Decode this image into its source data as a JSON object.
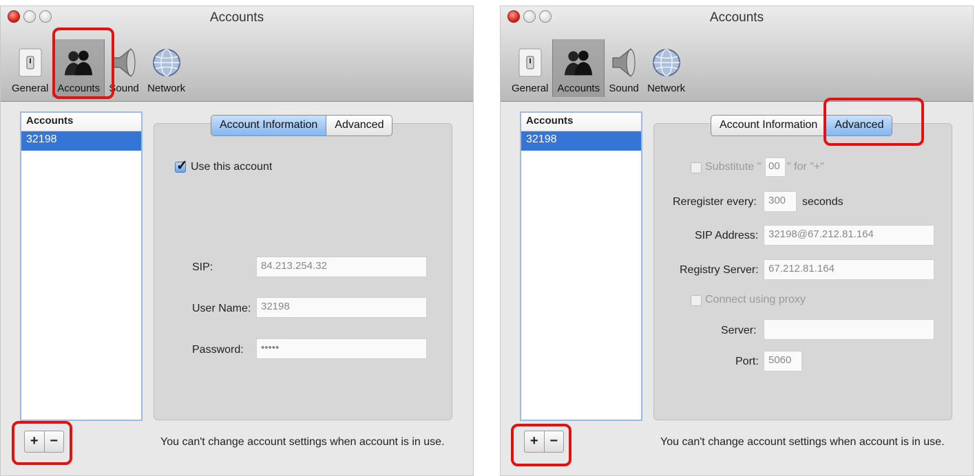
{
  "left": {
    "title": "Accounts",
    "toolbar": [
      "General",
      "Accounts",
      "Sound",
      "Network"
    ],
    "list_header": "Accounts",
    "list_items": [
      "32198"
    ],
    "tabs": [
      "Account Information",
      "Advanced"
    ],
    "use_account_label": "Use this account",
    "sip_label": "SIP:",
    "sip_value": "84.213.254.32",
    "username_label": "User Name:",
    "username_value": "32198",
    "password_label": "Password:",
    "password_value": "•••••",
    "add_label": "+",
    "remove_label": "−",
    "footer": "You can't change account settings when account is in use."
  },
  "right": {
    "title": "Accounts",
    "toolbar": [
      "General",
      "Accounts",
      "Sound",
      "Network"
    ],
    "list_header": "Accounts",
    "list_items": [
      "32198"
    ],
    "tabs": [
      "Account Information",
      "Advanced"
    ],
    "substitute_prefix": "Substitute \"",
    "substitute_value": "00",
    "substitute_suffix": "\" for \"+\"",
    "reregister_label": "Reregister every:",
    "reregister_value": "300",
    "reregister_unit": "seconds",
    "sip_address_label": "SIP Address:",
    "sip_address_value": "32198@67.212.81.164",
    "registry_label": "Registry Server:",
    "registry_value": "67.212.81.164",
    "proxy_label": "Connect using proxy",
    "server_label": "Server:",
    "server_value": "",
    "port_label": "Port:",
    "port_value": "5060",
    "add_label": "+",
    "remove_label": "−",
    "footer": "You can't change account settings when account is in use."
  },
  "colors": {
    "highlight": "#e31212",
    "selection": "#3475d6",
    "active_tab": "#83b6ee"
  }
}
